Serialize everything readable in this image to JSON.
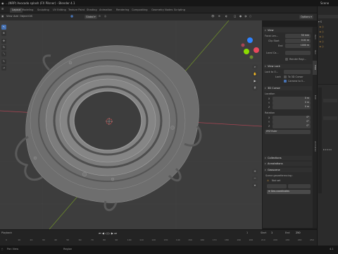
{
  "titlebar": {
    "title": "...(NRP) Avocado splash (FX Pilsner) - Blender 4.1",
    "scene_label": "Scene"
  },
  "workspaces": {
    "tabs": [
      "Layout",
      "Modeling",
      "Sculpting",
      "UV Editing",
      "Texture Paint",
      "Shading",
      "Animation",
      "Rendering",
      "Compositing",
      "Geometry Nodes",
      "Scripting"
    ],
    "active": "Layout"
  },
  "viewport_header": {
    "menus": [
      "View",
      "Add",
      "Object",
      "GIS"
    ],
    "orientation": "Global",
    "options_label": "Options"
  },
  "npanel": {
    "view_section": "View",
    "focal_length_label": "Focal Len...",
    "focal_length_value": "50 mm",
    "clip_start_label": "Clip Start",
    "clip_start_value": "0.01 m",
    "clip_end_label": "End",
    "clip_end_value": "1000 m",
    "local_camera_label": "Local Ca...",
    "render_region_label": "Render Regi...",
    "view_lock_section": "View Lock",
    "lock_to_object_label": "Lock to O...",
    "lock_label": "Lock",
    "to_3d_cursor_label": "To 3D Cursor",
    "camera_to_view_label": "Camera to V...",
    "cursor_section": "3D Cursor",
    "location_label": "Location",
    "x_label": "X",
    "y_label": "Y",
    "z_label": "Z",
    "loc_x": "0 m",
    "loc_y": "0 m",
    "loc_z": "0 m",
    "rotation_label": "Rotation",
    "rot_x": "0°",
    "rot_y": "0°",
    "rot_z": "0°",
    "rotation_mode": "XYZ Euler",
    "collections_section": "Collections",
    "annotations_section": "Annotations",
    "geoscene_section": "Geoscene",
    "geoscene_label": "Scene georeferencing :",
    "not_set_label": "Not set",
    "geo_button": "Geo-coordinates",
    "tabs": [
      "Item",
      "Tool",
      "View",
      "Edit",
      "Animation"
    ]
  },
  "timeline": {
    "playback_label": "Playback",
    "keying_label": "Keying",
    "view_label": "View",
    "marker_label": "Marker",
    "current_frame": "1",
    "start_label": "Start",
    "start_value": "1",
    "end_label": "End",
    "end_value": "250",
    "ruler_ticks": [
      "0",
      "10",
      "20",
      "30",
      "40",
      "50",
      "60",
      "70",
      "80",
      "90",
      "100",
      "110",
      "120",
      "130",
      "140",
      "150",
      "160",
      "170",
      "180",
      "190",
      "200",
      "210",
      "220",
      "230",
      "240",
      "250"
    ]
  },
  "statusbar": {
    "left_hint": "Pan View",
    "mid_hint": "Region",
    "version": "4.1"
  },
  "colors": {
    "accent": "#4772b3",
    "x_axis": "#e8485c",
    "y_axis": "#8bdc00",
    "z_axis": "#2f83ff",
    "viewport_bg": "#3d3d3d",
    "mesh": "#8a8a8a"
  }
}
